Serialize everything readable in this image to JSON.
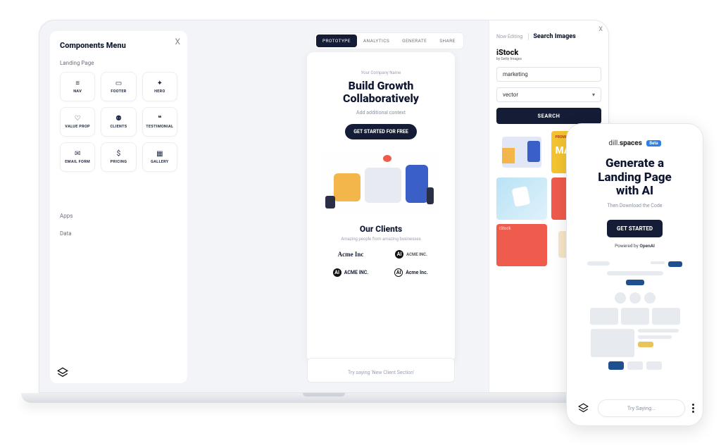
{
  "sidebar": {
    "title": "Components Menu",
    "close": "X",
    "section_landing": "Landing Page",
    "components": [
      {
        "icon": "≡",
        "label": "NAV"
      },
      {
        "icon": "▭",
        "label": "FOOTER"
      },
      {
        "icon": "✦",
        "label": "HERO"
      },
      {
        "icon": "♡",
        "label": "VALUE PROP"
      },
      {
        "icon": "⚉",
        "label": "CLIENTS"
      },
      {
        "icon": "❝",
        "label": "TESTIMONIAL"
      },
      {
        "icon": "✉",
        "label": "EMAIL FORM"
      },
      {
        "icon": "$",
        "label": "PRICING"
      },
      {
        "icon": "▦",
        "label": "GALLERY"
      }
    ],
    "section_apps": "Apps",
    "section_data": "Data"
  },
  "tabs": [
    "PROTOTYPE",
    "ANALYTICS",
    "GENERATE",
    "SHARE"
  ],
  "canvas": {
    "company": "Your Company Name",
    "hero_line1": "Build Growth",
    "hero_line2": "Collaboratively",
    "hero_sub": "Add additional context",
    "cta": "GET STARTED FOR FREE",
    "clients_title": "Our Clients",
    "clients_sub": "Amazing people from amazing businesses",
    "clients": [
      {
        "name": "Acme Inc",
        "style": "script"
      },
      {
        "name": "ACME INC."
      },
      {
        "name": "ACME INC."
      },
      {
        "name": "Acme Inc."
      }
    ]
  },
  "prompt": "Try saying 'New Client Section'",
  "imgpanel": {
    "nowedit": "Now Editing",
    "title": "Search Images",
    "brand": "iStock",
    "brand_sub": "by Getty Images",
    "search_value": "marketing",
    "filter_value": "vector",
    "search_btn": "SEARCH"
  },
  "phone": {
    "brand_pre": "dill.",
    "brand": "spaces",
    "beta": "Beta",
    "hero_l1": "Generate a",
    "hero_l2": "Landing Page",
    "hero_l3": "with AI",
    "sub": "Then Download the Code",
    "cta": "GET STARTED",
    "powered_pre": "Powered by ",
    "powered_b": "OpenAI",
    "prompt": "Try Saying..."
  }
}
